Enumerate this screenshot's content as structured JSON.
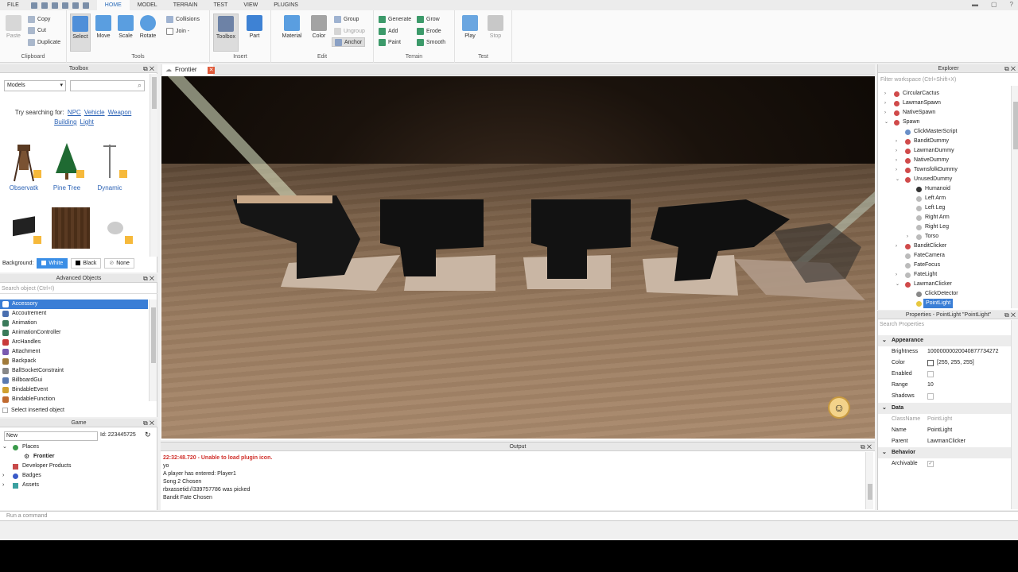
{
  "menubar": {
    "file": "FILE",
    "tabs": [
      "HOME",
      "MODEL",
      "TERRAIN",
      "TEST",
      "VIEW",
      "PLUGINS"
    ]
  },
  "ribbon": {
    "clipboard": {
      "label": "Clipboard",
      "paste": "Paste",
      "copy": "Copy",
      "cut": "Cut",
      "duplicate": "Duplicate"
    },
    "tools": {
      "label": "Tools",
      "select": "Select",
      "move": "Move",
      "scale": "Scale",
      "rotate": "Rotate",
      "collisions": "Collisions",
      "join": "Join -"
    },
    "insert": {
      "label": "Insert",
      "toolbox": "Toolbox",
      "part": "Part"
    },
    "edit": {
      "label": "Edit",
      "material": "Material",
      "color": "Color",
      "group": "Group",
      "ungroup": "Ungroup",
      "anchor": "Anchor"
    },
    "terrain": {
      "label": "Terrain",
      "generate": "Generate",
      "add": "Add",
      "paint": "Paint",
      "grow": "Grow",
      "erode": "Erode",
      "smooth": "Smooth"
    },
    "test": {
      "label": "Test",
      "play": "Play",
      "stop": "Stop"
    }
  },
  "toolbox": {
    "title": "Toolbox",
    "category": "Models",
    "try_prefix": "Try searching for:",
    "suggestions": [
      "NPC",
      "Vehicle",
      "Weapon",
      "Building",
      "Light"
    ],
    "items": [
      "Observatk",
      "Pine Tree",
      "Dynamic"
    ],
    "background_label": "Background:",
    "bg_options": [
      "White",
      "Black",
      "None"
    ]
  },
  "advanced": {
    "title": "Advanced Objects",
    "search_placeholder": "Search object (Ctrl+I)",
    "items": [
      "Accessory",
      "Accoutrement",
      "Animation",
      "AnimationController",
      "ArcHandles",
      "Attachment",
      "Backpack",
      "BallSocketConstraint",
      "BillboardGui",
      "BindableEvent",
      "BindableFunction"
    ],
    "select_inserted": "Select inserted object"
  },
  "game": {
    "title": "Game",
    "new_value": "New",
    "id": "Id: 223445725",
    "places": "Places",
    "place": "Frontier",
    "devproducts": "Developer Products",
    "badges": "Badges",
    "assets": "Assets"
  },
  "viewport": {
    "tab": "Frontier"
  },
  "output": {
    "title": "Output",
    "lines": [
      "22:32:48.720 - Unable to load plugin icon.",
      "yo",
      "A player has entered: Player1",
      "Song 2 Chosen",
      "rbxassetid://339757786 was picked",
      "Bandit Fate Chosen"
    ],
    "error_color": "#d0302b"
  },
  "explorer": {
    "title": "Explorer",
    "filter_placeholder": "Filter workspace (Ctrl+Shift+X)",
    "items": [
      {
        "label": "CircularCactus",
        "depth": 1,
        "arrow": "›",
        "color": "#d04a4a"
      },
      {
        "label": "LawmanSpawn",
        "depth": 1,
        "arrow": "›",
        "color": "#d04a4a"
      },
      {
        "label": "NativeSpawn",
        "depth": 1,
        "arrow": "›",
        "color": "#d04a4a"
      },
      {
        "label": "Spawn",
        "depth": 1,
        "arrow": "⌄",
        "color": "#d04a4a"
      },
      {
        "label": "ClickMasterScript",
        "depth": 2,
        "arrow": "",
        "color": "#6a8fc8"
      },
      {
        "label": "BanditDummy",
        "depth": 2,
        "arrow": "›",
        "color": "#d04a4a"
      },
      {
        "label": "LawmanDummy",
        "depth": 2,
        "arrow": "›",
        "color": "#d04a4a"
      },
      {
        "label": "NativeDummy",
        "depth": 2,
        "arrow": "›",
        "color": "#d04a4a"
      },
      {
        "label": "TownsfolkDummy",
        "depth": 2,
        "arrow": "›",
        "color": "#d04a4a"
      },
      {
        "label": "UnusedDummy",
        "depth": 2,
        "arrow": "⌄",
        "color": "#d04a4a"
      },
      {
        "label": "Humanoid",
        "depth": 3,
        "arrow": "",
        "color": "#333"
      },
      {
        "label": "Left Arm",
        "depth": 3,
        "arrow": "",
        "color": "#bbb"
      },
      {
        "label": "Left Leg",
        "depth": 3,
        "arrow": "",
        "color": "#bbb"
      },
      {
        "label": "Right Arm",
        "depth": 3,
        "arrow": "",
        "color": "#bbb"
      },
      {
        "label": "Right Leg",
        "depth": 3,
        "arrow": "",
        "color": "#bbb"
      },
      {
        "label": "Torso",
        "depth": 3,
        "arrow": "›",
        "color": "#bbb"
      },
      {
        "label": "BanditClicker",
        "depth": 2,
        "arrow": "›",
        "color": "#d04a4a"
      },
      {
        "label": "FateCamera",
        "depth": 2,
        "arrow": "",
        "color": "#bbb"
      },
      {
        "label": "FateFocus",
        "depth": 2,
        "arrow": "",
        "color": "#bbb"
      },
      {
        "label": "FateLight",
        "depth": 2,
        "arrow": "›",
        "color": "#bbb"
      },
      {
        "label": "LawmanClicker",
        "depth": 2,
        "arrow": "⌄",
        "color": "#d04a4a"
      },
      {
        "label": "ClickDetector",
        "depth": 3,
        "arrow": "",
        "color": "#888"
      },
      {
        "label": "PointLight",
        "depth": 3,
        "arrow": "",
        "color": "#e8c840",
        "selected": true
      }
    ]
  },
  "properties": {
    "title": "Properties - PointLight \"PointLight\"",
    "search_placeholder": "Search Properties",
    "appearance": "Appearance",
    "brightness_k": "Brightness",
    "brightness_v": "10000000020040877734272",
    "color_k": "Color",
    "color_v": "[255, 255, 255]",
    "enabled_k": "Enabled",
    "range_k": "Range",
    "range_v": "10",
    "shadows_k": "Shadows",
    "data": "Data",
    "classname_k": "ClassName",
    "classname_v": "PointLight",
    "name_k": "Name",
    "name_v": "PointLight",
    "parent_k": "Parent",
    "parent_v": "LawmanClicker",
    "behavior": "Behavior",
    "archivable_k": "Archivable"
  },
  "command": {
    "placeholder": "Run a command"
  }
}
